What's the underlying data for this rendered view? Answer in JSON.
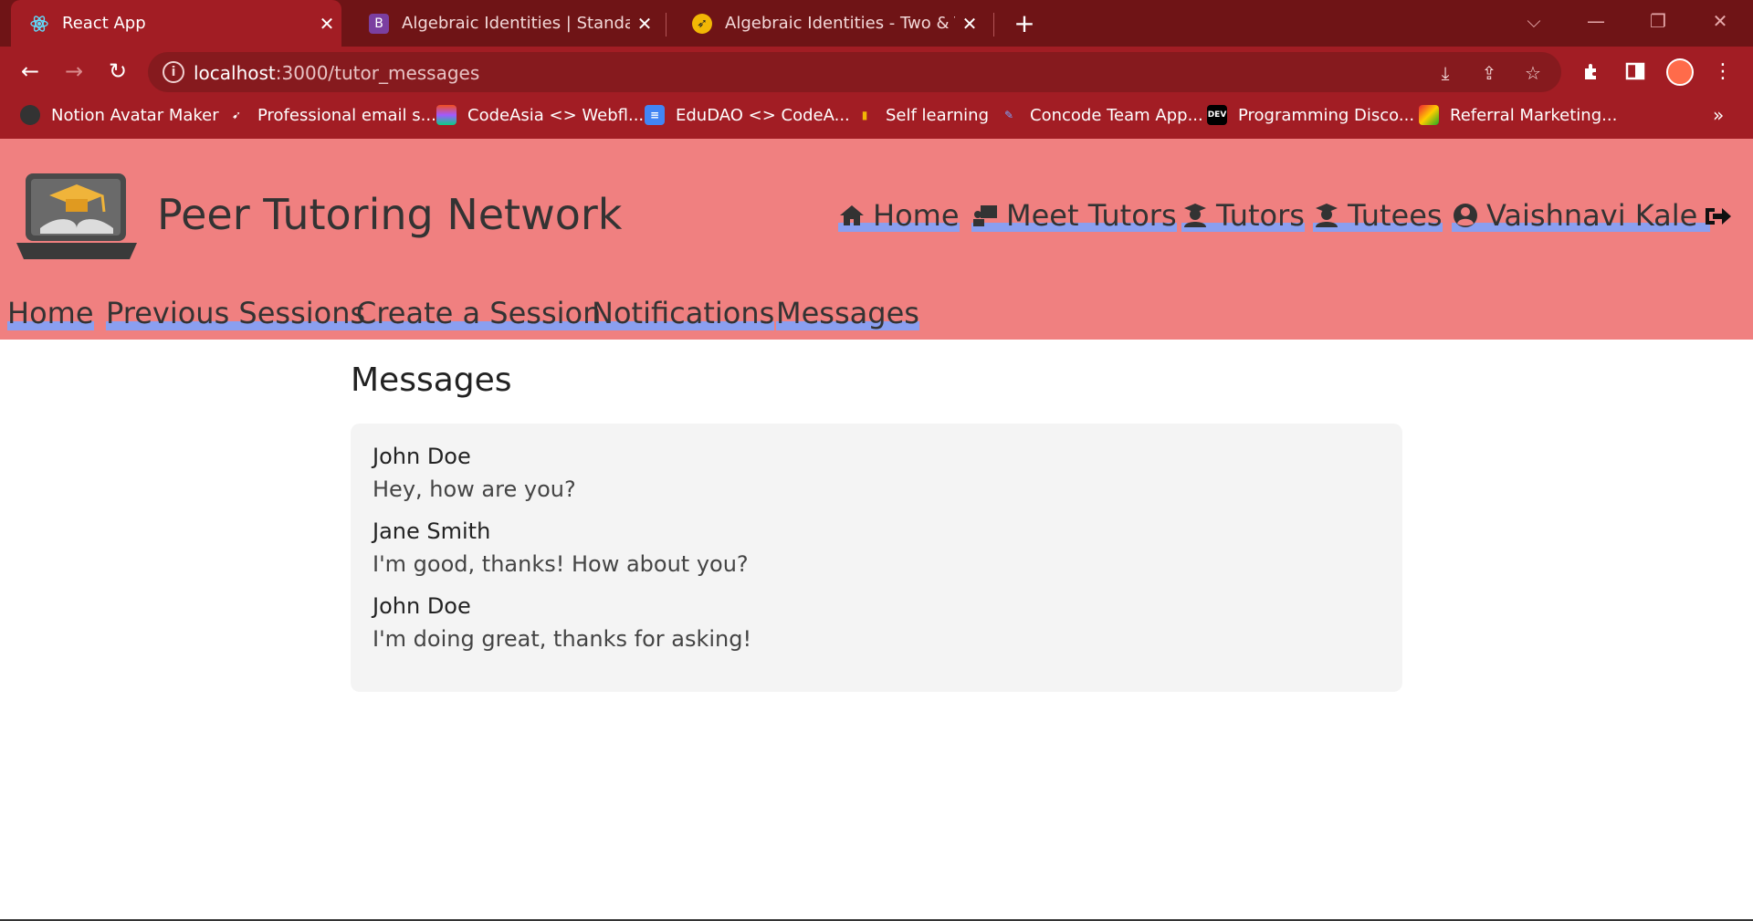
{
  "browser": {
    "tabs": [
      {
        "title": "React App",
        "active": true
      },
      {
        "title": "Algebraic Identities | Standard Alg",
        "active": false
      },
      {
        "title": "Algebraic Identities - Two & Thre",
        "active": false
      }
    ],
    "url_host": "localhost",
    "url_path": ":3000/tutor_messages",
    "bookmarks": [
      "Notion Avatar Maker",
      "Professional email s...",
      "CodeAsia <> Webfl...",
      "EduDAO <> CodeA...",
      "Self learning",
      "Concode Team App...",
      "Programming Disco...",
      "Referral Marketing..."
    ],
    "bookmark_icons": [
      "DEV"
    ]
  },
  "header": {
    "site_title": "Peer Tutoring Network",
    "main_nav": [
      "Home",
      "Meet Tutors",
      "Tutors",
      "Tutees",
      "Vaishnavi Kale"
    ],
    "sub_nav": [
      "Home",
      "Previous Sessions",
      "Create a Session",
      "Notifications",
      "Messages"
    ]
  },
  "main": {
    "title": "Messages",
    "messages": [
      {
        "sender": "John Doe",
        "text": "Hey, how are you?"
      },
      {
        "sender": "Jane Smith",
        "text": "I'm good, thanks! How about you?"
      },
      {
        "sender": "John Doe",
        "text": "I'm doing great, thanks for asking!"
      }
    ]
  },
  "colors": {
    "tabbar": "#6f1416",
    "toolbar": "#a21d24",
    "header_bg": "#f08080",
    "nav_underline": "#8a9ff0",
    "message_box": "#f4f4f4"
  }
}
